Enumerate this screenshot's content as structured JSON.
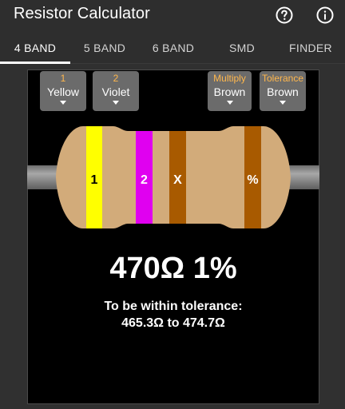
{
  "app": {
    "title": "Resistor Calculator",
    "help_icon": "help-circle-icon",
    "info_icon": "info-circle-icon"
  },
  "tabs": [
    {
      "label": "4 BAND",
      "active": true
    },
    {
      "label": "5 BAND",
      "active": false
    },
    {
      "label": "6 BAND",
      "active": false
    },
    {
      "label": "SMD",
      "active": false
    },
    {
      "label": "FINDER",
      "active": false
    }
  ],
  "selectors": [
    {
      "label": "1",
      "value": "Yellow"
    },
    {
      "label": "2",
      "value": "Violet"
    },
    {
      "label": "Multiply",
      "value": "Brown"
    },
    {
      "label": "Tolerance",
      "value": "Brown"
    }
  ],
  "resistor": {
    "bands": [
      {
        "marker": "1",
        "color": "#ffff00",
        "text_color": "#000000"
      },
      {
        "marker": "2",
        "color": "#e000f0",
        "text_color": "#ffffff"
      },
      {
        "marker": "X",
        "color": "#a85a00",
        "text_color": "#ffffff"
      },
      {
        "marker": "%",
        "color": "#a85a00",
        "text_color": "#ffffff"
      }
    ],
    "body_color": "#d2ab7a",
    "lead_color": "#8a8a8a"
  },
  "result": {
    "value": "470Ω 1%",
    "tolerance_heading": "To be within tolerance:",
    "tolerance_range": "465.3Ω to 474.7Ω"
  },
  "colors": {
    "accent_label": "#ffb74d",
    "background": "#303030",
    "panel": "#000000"
  }
}
